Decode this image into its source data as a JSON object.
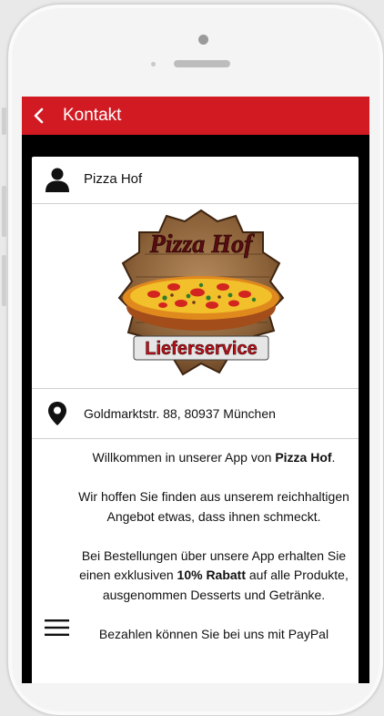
{
  "appbar": {
    "title": "Kontakt"
  },
  "contact": {
    "name": "Pizza Hof",
    "address": "Goldmarktstr. 88, 80937 München"
  },
  "logo": {
    "line1": "Pizza Hof",
    "line2": "Lieferservice"
  },
  "info": {
    "p1_pre": "Willkommen in unserer App von ",
    "p1_bold": "Pizza Hof",
    "p1_post": ".",
    "p2": "Wir hoffen Sie finden aus unserem reichhaltigen Angebot etwas, dass ihnen schmeckt.",
    "p3_pre": "Bei Bestellungen über unsere App erhalten Sie einen exklusiven ",
    "p3_bold": "10% Rabatt",
    "p3_post": " auf alle Produkte, ausgenommen Desserts und Getränke.",
    "p4": "Bezahlen können Sie bei uns mit PayPal"
  },
  "icons": {
    "back": "chevron-left-icon",
    "person": "person-icon",
    "location": "map-pin-icon",
    "menu": "hamburger-menu-icon"
  },
  "colors": {
    "appbar": "#d11a22",
    "background": "#000000",
    "card": "#ffffff"
  }
}
